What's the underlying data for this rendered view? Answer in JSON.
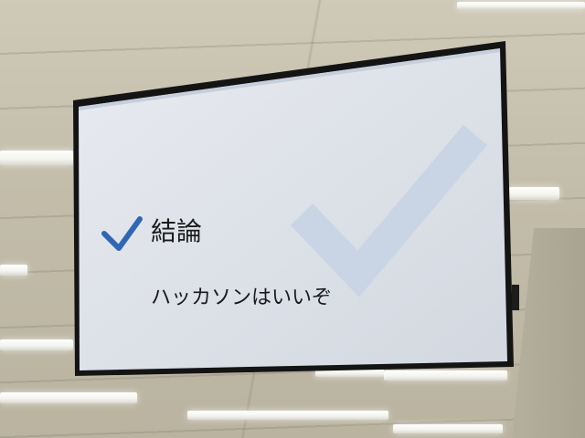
{
  "slide": {
    "heading": "結論",
    "body": "ハッカソンはいいぞ"
  },
  "colors": {
    "check_mark": "#2f67b5",
    "watermark_check": "#c9d4e4",
    "screen_bg": "#dfe3ea",
    "bezel": "#141414"
  },
  "icons": {
    "heading_icon": "checkmark-icon",
    "background_icon": "large-checkmark-watermark-icon"
  }
}
